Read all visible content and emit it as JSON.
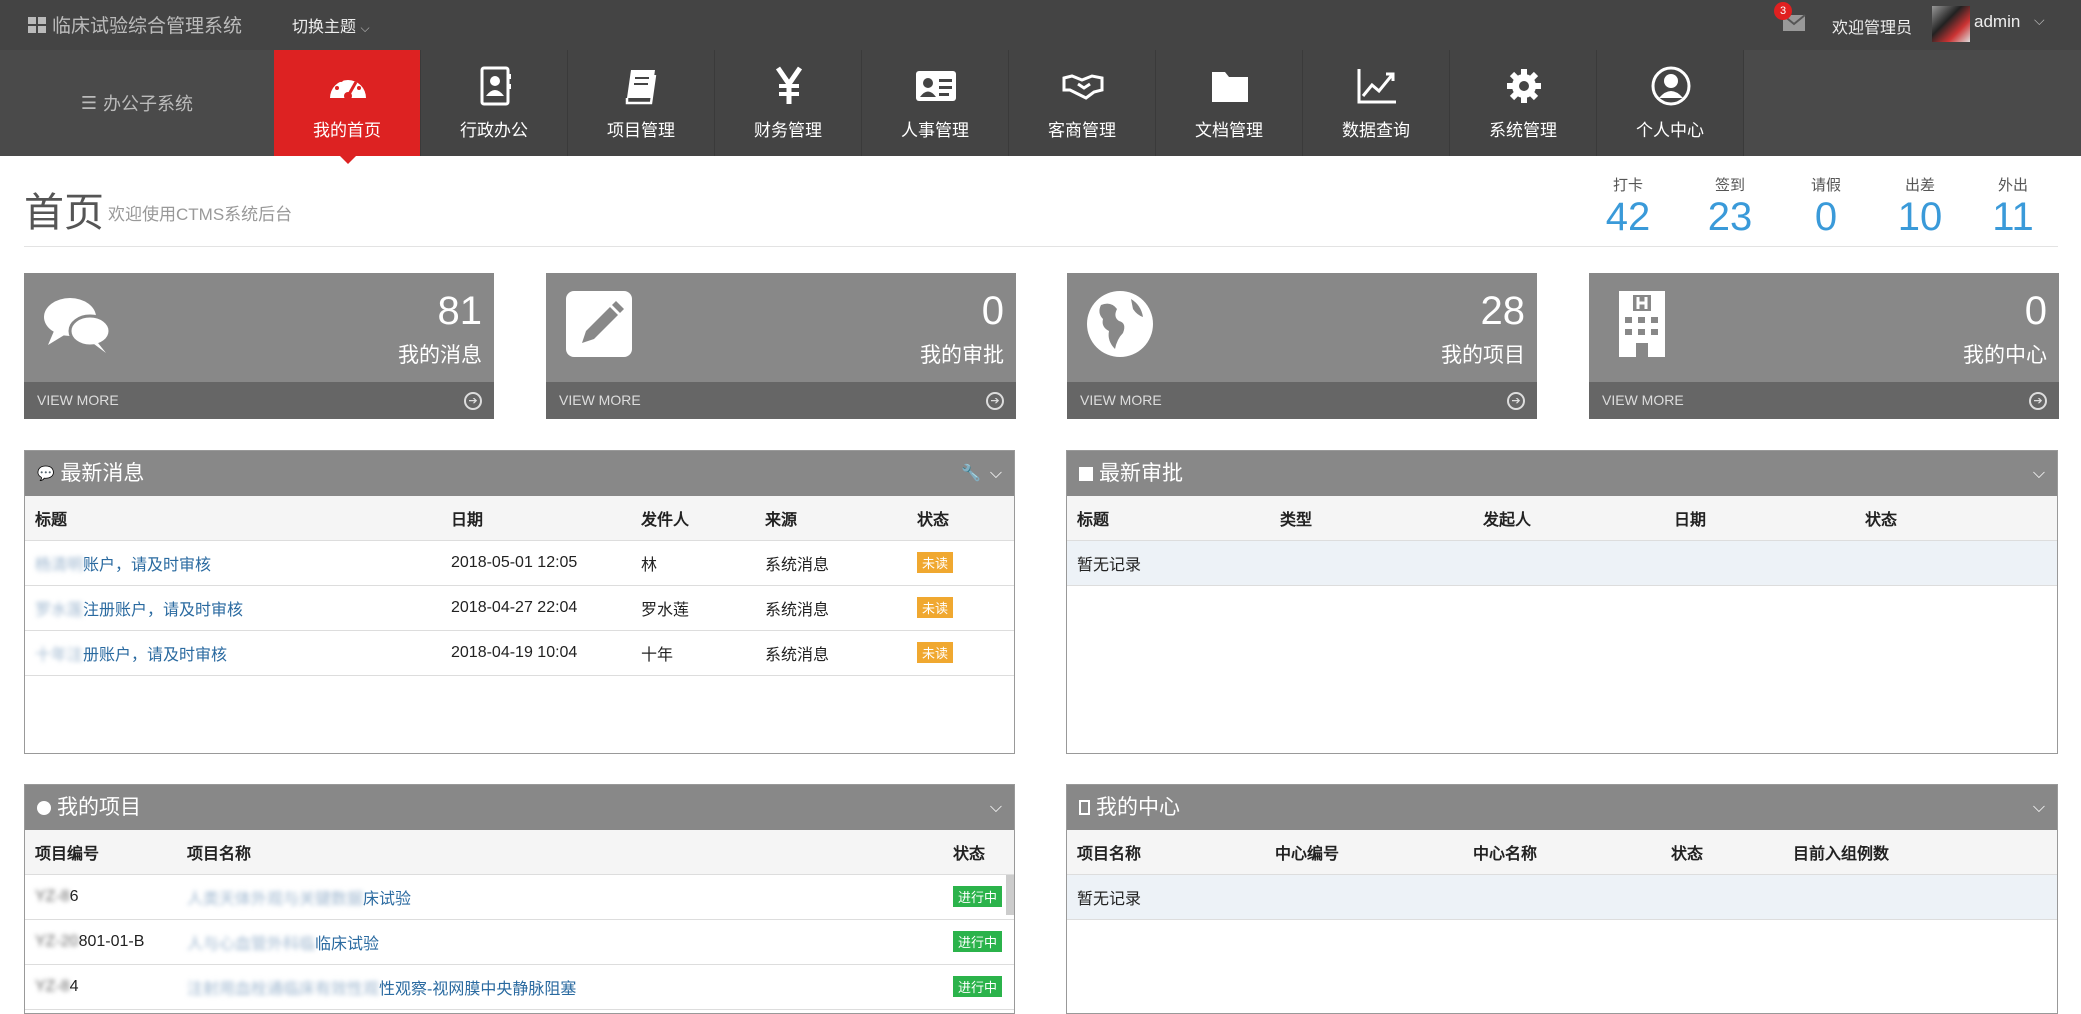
{
  "topbar": {
    "brand": "临床试验综合管理系统",
    "theme_switch": "切换主题",
    "mail_badge": "3",
    "welcome": "欢迎管理员",
    "username": "admin"
  },
  "nav": {
    "subsystem": "办公子系统",
    "items": [
      {
        "label": "我的首页",
        "icon": "dashboard-icon"
      },
      {
        "label": "行政办公",
        "icon": "contacts-book-icon"
      },
      {
        "label": "项目管理",
        "icon": "book-icon"
      },
      {
        "label": "财务管理",
        "icon": "yen-icon"
      },
      {
        "label": "人事管理",
        "icon": "id-card-icon"
      },
      {
        "label": "客商管理",
        "icon": "handshake-icon"
      },
      {
        "label": "文档管理",
        "icon": "folder-icon"
      },
      {
        "label": "数据查询",
        "icon": "line-chart-icon"
      },
      {
        "label": "系统管理",
        "icon": "gear-icon"
      },
      {
        "label": "个人中心",
        "icon": "user-circle-icon"
      }
    ],
    "active": "我的首页"
  },
  "page": {
    "title": "首页",
    "subtitle": "欢迎使用CTMS系统后台"
  },
  "stats": [
    {
      "label": "打卡",
      "value": "42"
    },
    {
      "label": "签到",
      "value": "23"
    },
    {
      "label": "请假",
      "value": "0"
    },
    {
      "label": "出差",
      "value": "10"
    },
    {
      "label": "外出",
      "value": "11"
    }
  ],
  "tiles": [
    {
      "value": "81",
      "label": "我的消息",
      "more": "VIEW MORE",
      "icon": "chat-bubbles-icon"
    },
    {
      "value": "0",
      "label": "我的审批",
      "more": "VIEW MORE",
      "icon": "pencil-icon"
    },
    {
      "value": "28",
      "label": "我的项目",
      "more": "VIEW MORE",
      "icon": "globe-icon"
    },
    {
      "value": "0",
      "label": "我的中心",
      "more": "VIEW MORE",
      "icon": "hospital-icon"
    }
  ],
  "messages": {
    "title": "最新消息",
    "headers": [
      "标题",
      "日期",
      "发件人",
      "来源",
      "状态"
    ],
    "rows": [
      {
        "title_hidden": "杨清明",
        "title": "账户，请及时审核",
        "date": "2018-05-01 12:05",
        "sender": "林",
        "source": "系统消息",
        "status": "未读"
      },
      {
        "title_hidden": "罗水莲",
        "title": "注册账户，请及时审核",
        "date": "2018-04-27 22:04",
        "sender": "罗水莲",
        "source": "系统消息",
        "status": "未读"
      },
      {
        "title_hidden": "十年注",
        "title": "册账户，请及时审核",
        "date": "2018-04-19 10:04",
        "sender": "十年",
        "source": "系统消息",
        "status": "未读"
      }
    ]
  },
  "approvals": {
    "title": "最新审批",
    "headers": [
      "标题",
      "类型",
      "发起人",
      "日期",
      "状态"
    ],
    "empty": "暂无记录"
  },
  "projects": {
    "title": "我的项目",
    "headers": [
      "项目编号",
      "项目名称",
      "状态"
    ],
    "rows": [
      {
        "code_hidden": "YZ-8",
        "code": "6",
        "name_hidden": "人类天体外观与关键数据",
        "name": "床试验",
        "status": "进行中"
      },
      {
        "code_hidden": "YZ-20",
        "code": "801-01-B",
        "name_hidden": "人与心血管外科临",
        "name": "临床试验",
        "status": "进行中"
      },
      {
        "code_hidden": "YZ-8",
        "code": "4",
        "name_hidden": "注射用血栓通临床有效性观",
        "name": "性观察-视网膜中央静脉阻塞",
        "status": "进行中"
      }
    ]
  },
  "centers": {
    "title": "我的中心",
    "headers": [
      "项目名称",
      "中心编号",
      "中心名称",
      "状态",
      "目前入组例数"
    ],
    "empty": "暂无记录"
  }
}
